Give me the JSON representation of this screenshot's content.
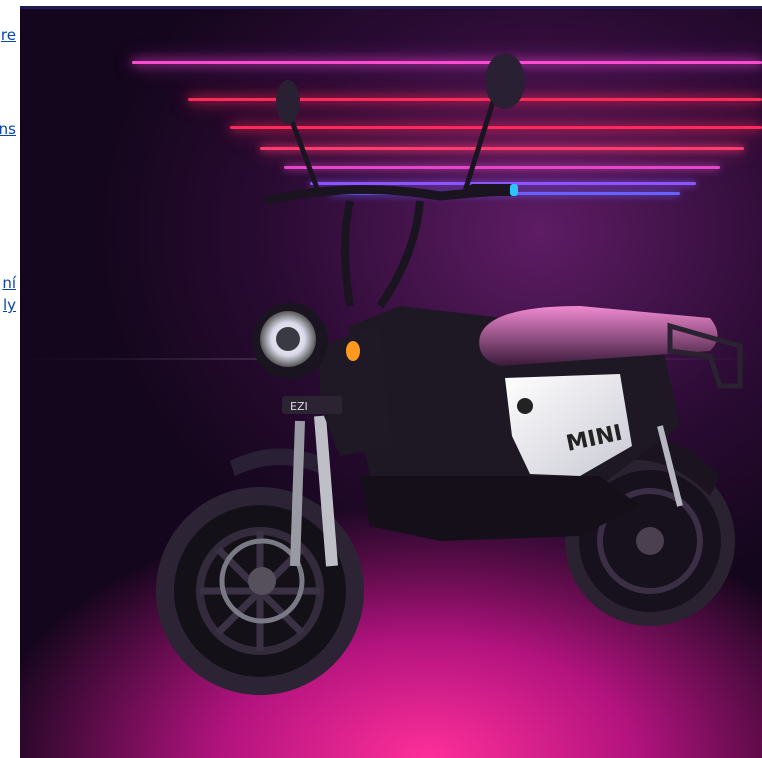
{
  "side_links": [
    "re",
    "ns",
    "ní",
    "ly"
  ],
  "hero": {
    "brand_badge": "EZI",
    "model_label": "MINI"
  },
  "colors": {
    "neon_pink": "#ff4bd1",
    "neon_red": "#ff2a5a",
    "neon_blue": "#7a5cff",
    "link": "#0645ad"
  }
}
